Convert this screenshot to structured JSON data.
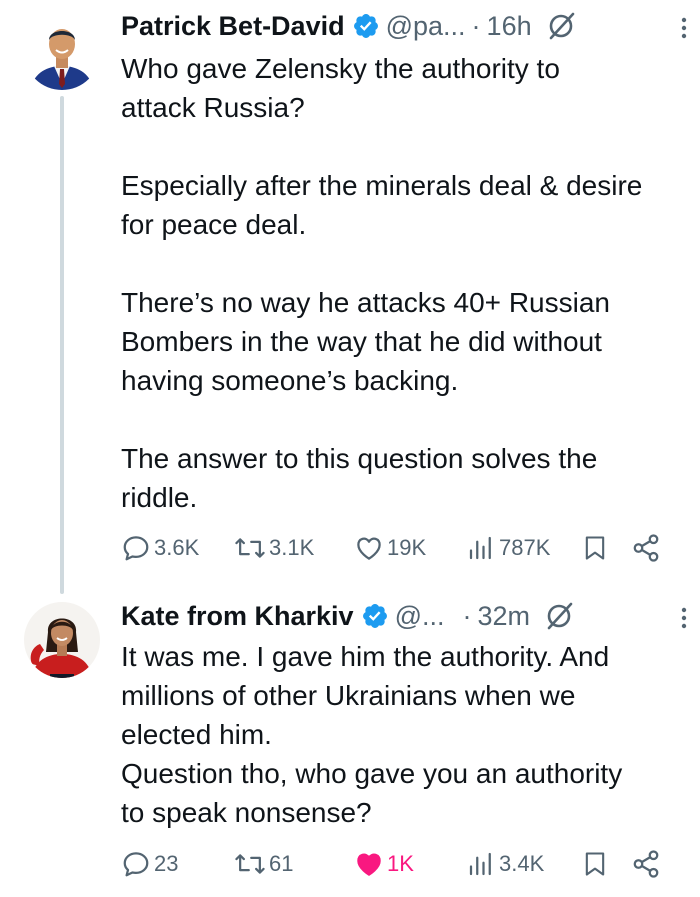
{
  "colors": {
    "text_primary": "#0f1419",
    "text_secondary": "#536471",
    "verified_badge": "#1d9bf0",
    "like_active": "#f91880",
    "thread_line": "#cfd9de"
  },
  "tweets": [
    {
      "display_name": "Patrick Bet-David",
      "handle": "@pa...",
      "separator": "·",
      "time": "16h",
      "verified": true,
      "body": "Who gave Zelensky the authority to\nattack Russia?\n\nEspecially after the minerals deal & desire\nfor peace deal.\n\nThere’s no way he attacks 40+ Russian\nBombers in the way that he did without\nhaving someone’s backing.\n\nThe answer to this question solves the\nriddle.",
      "actions": {
        "replies": "3.6K",
        "reposts": "3.1K",
        "likes": "19K",
        "views": "787K",
        "liked": false
      },
      "icons": [
        "verified-badge-icon",
        "grok-icon",
        "more-icon",
        "reply-icon",
        "repost-icon",
        "like-icon",
        "views-icon",
        "bookmark-icon",
        "share-icon"
      ]
    },
    {
      "display_name": "Kate from Kharkiv",
      "handle": "@...",
      "separator": "·",
      "time": "32m",
      "verified": true,
      "body": "It was me. I gave him the authority.  And\nmillions of other Ukrainians when we\nelected him.\nQuestion tho, who gave you an authority\nto speak nonsense?",
      "actions": {
        "replies": "23",
        "reposts": "61",
        "likes": "1K",
        "views": "3.4K",
        "liked": true
      },
      "icons": [
        "verified-badge-icon",
        "grok-icon",
        "more-icon",
        "reply-icon",
        "repost-icon",
        "like-filled-icon",
        "views-icon",
        "bookmark-icon",
        "share-icon"
      ]
    }
  ]
}
